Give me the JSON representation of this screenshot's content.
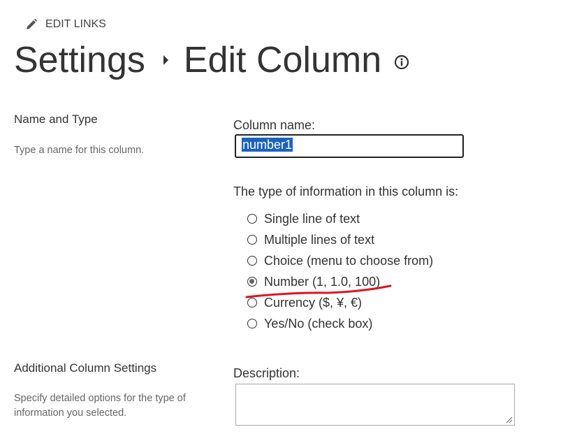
{
  "header": {
    "edit_links": "EDIT LINKS",
    "breadcrumb_parent": "Settings",
    "page_title": "Edit Column"
  },
  "name_section": {
    "title": "Name and Type",
    "description": "Type a name for this column.",
    "column_name_label": "Column name:",
    "column_name_value": "number1",
    "type_label": "The type of information in this column is:",
    "types": [
      {
        "label": "Single line of text",
        "checked": false
      },
      {
        "label": "Multiple lines of text",
        "checked": false
      },
      {
        "label": "Choice (menu to choose from)",
        "checked": false
      },
      {
        "label": "Number (1, 1.0, 100)",
        "checked": true
      },
      {
        "label": "Currency ($, ¥, €)",
        "checked": false
      },
      {
        "label": "Yes/No (check box)",
        "checked": false
      }
    ]
  },
  "additional_section": {
    "title": "Additional Column Settings",
    "description": "Specify detailed options for the type of information you selected.",
    "description_label": "Description:",
    "description_value": ""
  },
  "colors": {
    "selection": "#1a62c5",
    "annotation": "#e0141e",
    "text": "#333333",
    "muted": "#666666"
  },
  "icons": [
    "pencil-icon",
    "info-icon",
    "resize-grip-icon"
  ]
}
